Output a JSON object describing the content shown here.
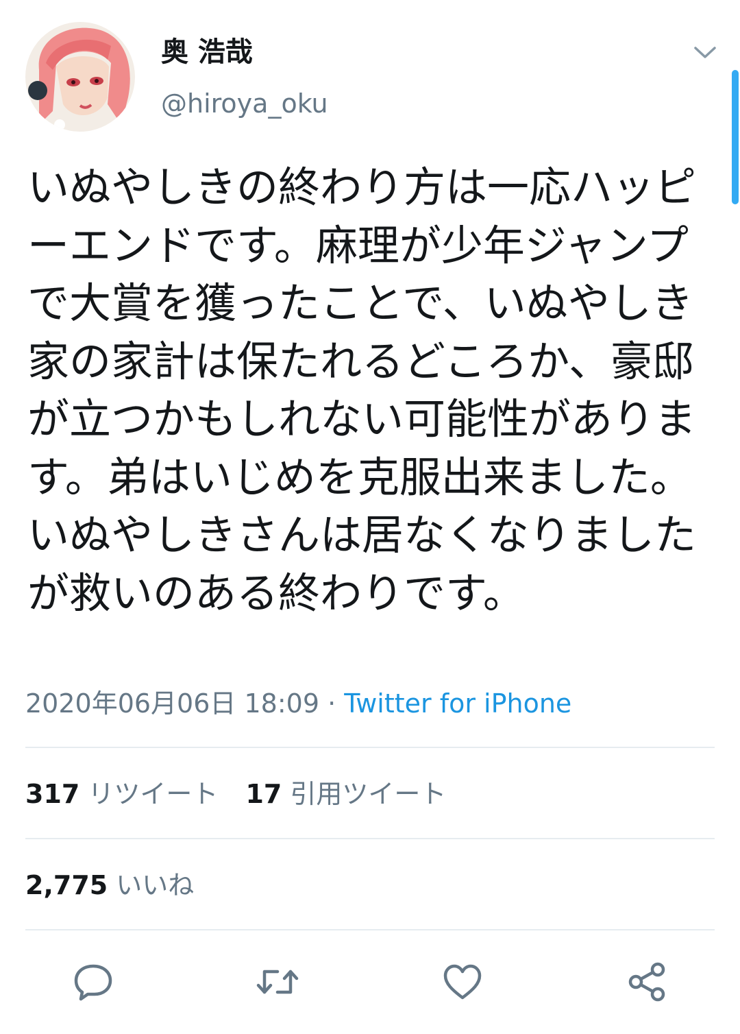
{
  "user": {
    "display_name": "奥 浩哉",
    "handle": "@hiroya_oku"
  },
  "tweet": {
    "text": "いぬやしきの終わり方は一応ハッピーエンドです。麻理が少年ジャンプで大賞を獲ったことで、いぬやしき家の家計は保たれるどころか、豪邸が立つかもしれない可能性があります。弟はいじめを克服出来ました。いぬやしきさんは居なくなりましたが救いのある終わりです。",
    "timestamp": "2020年06月06日 18:09",
    "separator": " · ",
    "source": "Twitter for iPhone"
  },
  "stats": {
    "retweets_count": "317",
    "retweets_label": "リツイート",
    "quotes_count": "17",
    "quotes_label": "引用ツイート",
    "likes_count": "2,775",
    "likes_label": "いいね"
  },
  "icons": {
    "caret": "chevron-down-icon",
    "reply": "reply-icon",
    "retweet": "retweet-icon",
    "like": "heart-icon",
    "share": "share-icon"
  },
  "colors": {
    "text": "#14171a",
    "secondary": "#657786",
    "link": "#1b95e0",
    "accent": "#1da1f2",
    "divider": "#e6ecf0"
  }
}
